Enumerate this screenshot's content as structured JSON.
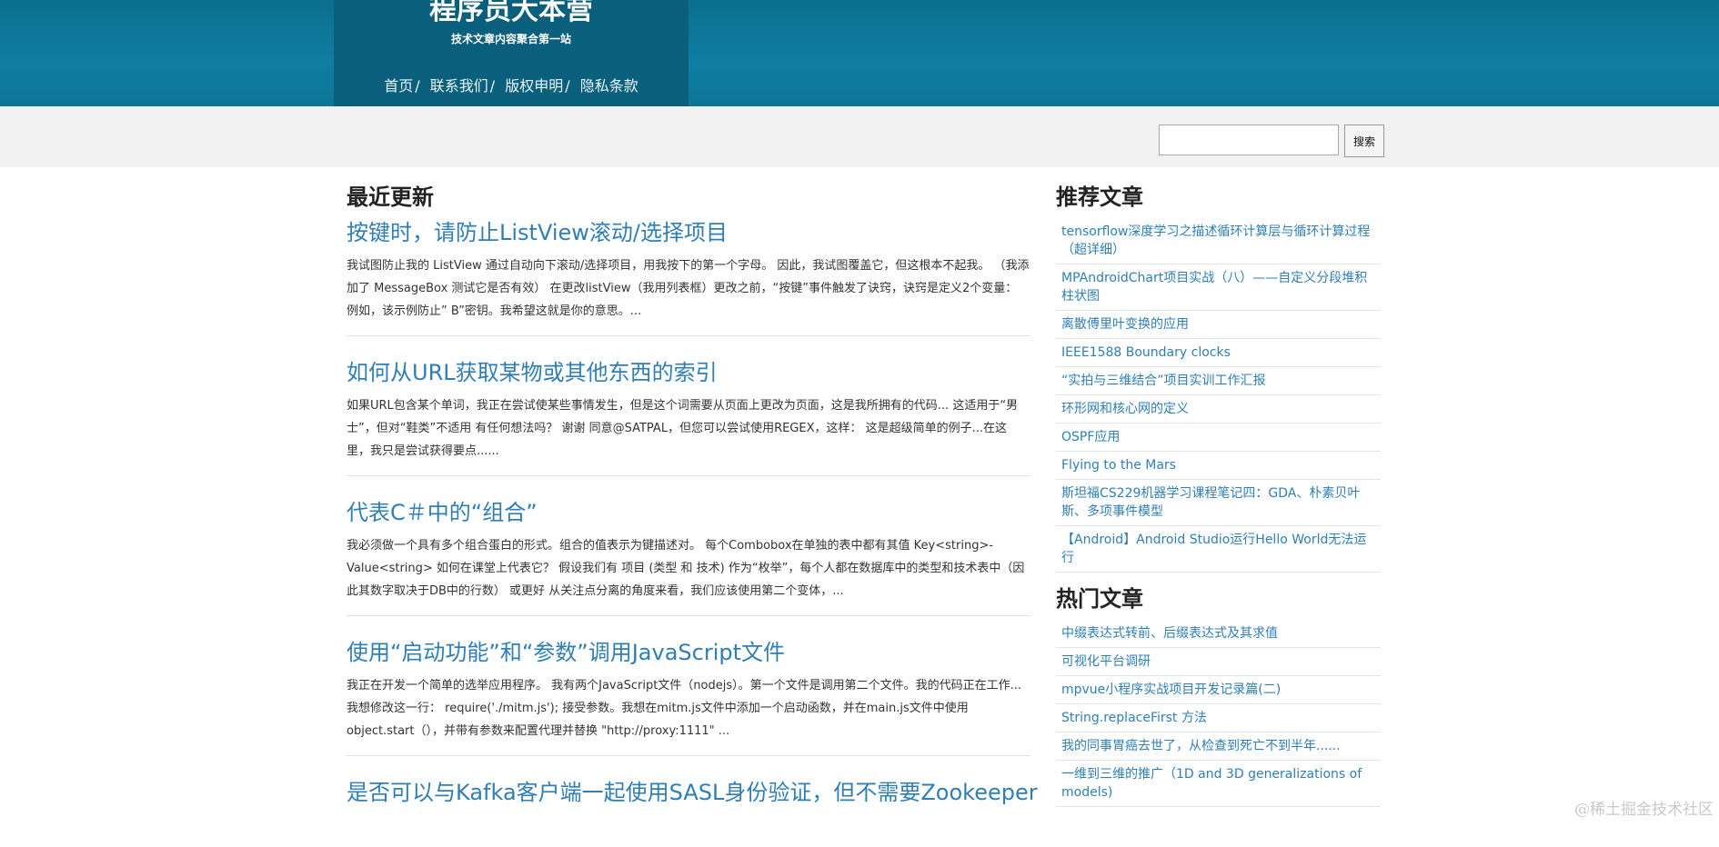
{
  "header": {
    "site_title": "程序员大本营",
    "subtitle": "技术文章内容聚合第一站",
    "nav": [
      {
        "label": "首页",
        "sep": "/"
      },
      {
        "label": "联系我们",
        "sep": "/"
      },
      {
        "label": "版权申明",
        "sep": "/"
      },
      {
        "label": "隐私条款",
        "sep": ""
      }
    ]
  },
  "search": {
    "value": "",
    "button_label": "搜索"
  },
  "main": {
    "heading": "最近更新",
    "articles": [
      {
        "title": "按键时，请防止ListView滚动/选择项目",
        "excerpt": "我试图防止我的 ListView 通过自动向下滚动/选择项目，用我按下的第一个字母。 因此，我试图覆盖它，但这根本不起我。 （我添加了 MessageBox 测试它是否有效） 在更改listView（我用列表框）更改之前，“按键”事件触发了诀窍，诀窍是定义2个变量： 例如，该示例防止” B”密钥。我希望这就是你的意思。..."
      },
      {
        "title": "如何从URL获取某物或其他东西的索引",
        "excerpt": "如果URL包含某个单词，我正在尝试使某些事情发生，但是这个词需要从页面上更改为页面，这是我所拥有的代码... 这适用于“男士”，但对“鞋类”不适用 有任何想法吗？ 谢谢 同意@SATPAL，但您可以尝试使用REGEX，这样： 这是超级简单的例子...在这里，我只是尝试获得要点......"
      },
      {
        "title": "代表C＃中的“组合”",
        "excerpt": "我必须做一个具有多个组合蛋白的形式。组合的值表示为键描述对。 每个Combobox在单独的表中都有其值 Key<string>-Value<string> 如何在课堂上代表它？ 假设我们有 项目 (类型 和 技术) 作为“枚举”，每个人都在数据库中的类型和技术表中（因此其数字取决于DB中的行数） 或更好 从关注点分离的角度来看，我们应该使用第二个变体，..."
      },
      {
        "title": "使用“启动功能”和“参数”调用JavaScript文件",
        "excerpt": "我正在开发一个简单的选举应用程序。 我有两个JavaScript文件（nodejs）。第一个文件是调用第二个文件。我的代码正在工作... 我想修改这一行： require('./mitm.js'); 接受参数。我想在mitm.js文件中添加一个启动函数，并在main.js文件中使用object.start（），并带有参数来配置代理并替换 \"http://proxy:1111\" ..."
      },
      {
        "title": "是否可以与Kafka客户端一起使用SASL身份验证，但不需要Zookeeper",
        "excerpt": ""
      }
    ]
  },
  "sidebar": {
    "recommended_heading": "推荐文章",
    "recommended": [
      "tensorflow深度学习之描述循环计算层与循环计算过程（超详细）",
      "MPAndroidChart项目实战（八）——自定义分段堆积柱状图",
      "离散傅里叶变换的应用",
      "IEEE1588 Boundary clocks",
      "“实拍与三维结合”项目实训工作汇报",
      "环形网和核心网的定义",
      "OSPF应用",
      "Flying to the Mars",
      "斯坦福CS229机器学习课程笔记四：GDA、朴素贝叶斯、多项事件模型",
      "【Android】Android Studio运行Hello World无法运行"
    ],
    "hot_heading": "热门文章",
    "hot": [
      "中缀表达式转前、后缀表达式及其求值",
      "可视化平台调研",
      "mpvue小程序实战项目开发记录篇(二)",
      "String.replaceFirst 方法",
      "我的同事胃癌去世了，从检查到死亡不到半年......",
      "一维到三维的推广（1D and 3D generalizations of models)"
    ]
  },
  "watermark": "@稀土掘金技术社区"
}
